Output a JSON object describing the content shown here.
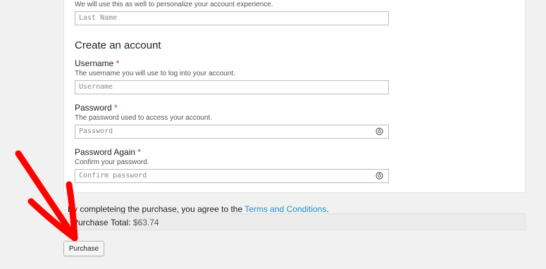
{
  "form": {
    "last_name_hint": "We will use this as well to personalize your account experience.",
    "last_name_placeholder": "Last Name",
    "section_title": "Create an account",
    "username": {
      "label": "Username",
      "required_mark": "*",
      "hint": "The username you will use to log into your account.",
      "placeholder": "Username"
    },
    "password": {
      "label": "Password",
      "required_mark": "*",
      "hint": "The password used to access your account.",
      "placeholder": "Password"
    },
    "password_again": {
      "label": "Password Again",
      "required_mark": "*",
      "hint": "Confirm your password.",
      "placeholder": "Confirm password"
    }
  },
  "agreement": {
    "prefix": "By completeing the purchase, you agree to the",
    "link": "Terms and Conditions",
    "suffix": "."
  },
  "total": {
    "label": "Purchase Total:",
    "amount": "$63.74"
  },
  "purchase_button": "Purchase",
  "colors": {
    "annotation_arrow": "#ff0000",
    "link": "#1e90c8",
    "required": "#c0392b"
  }
}
